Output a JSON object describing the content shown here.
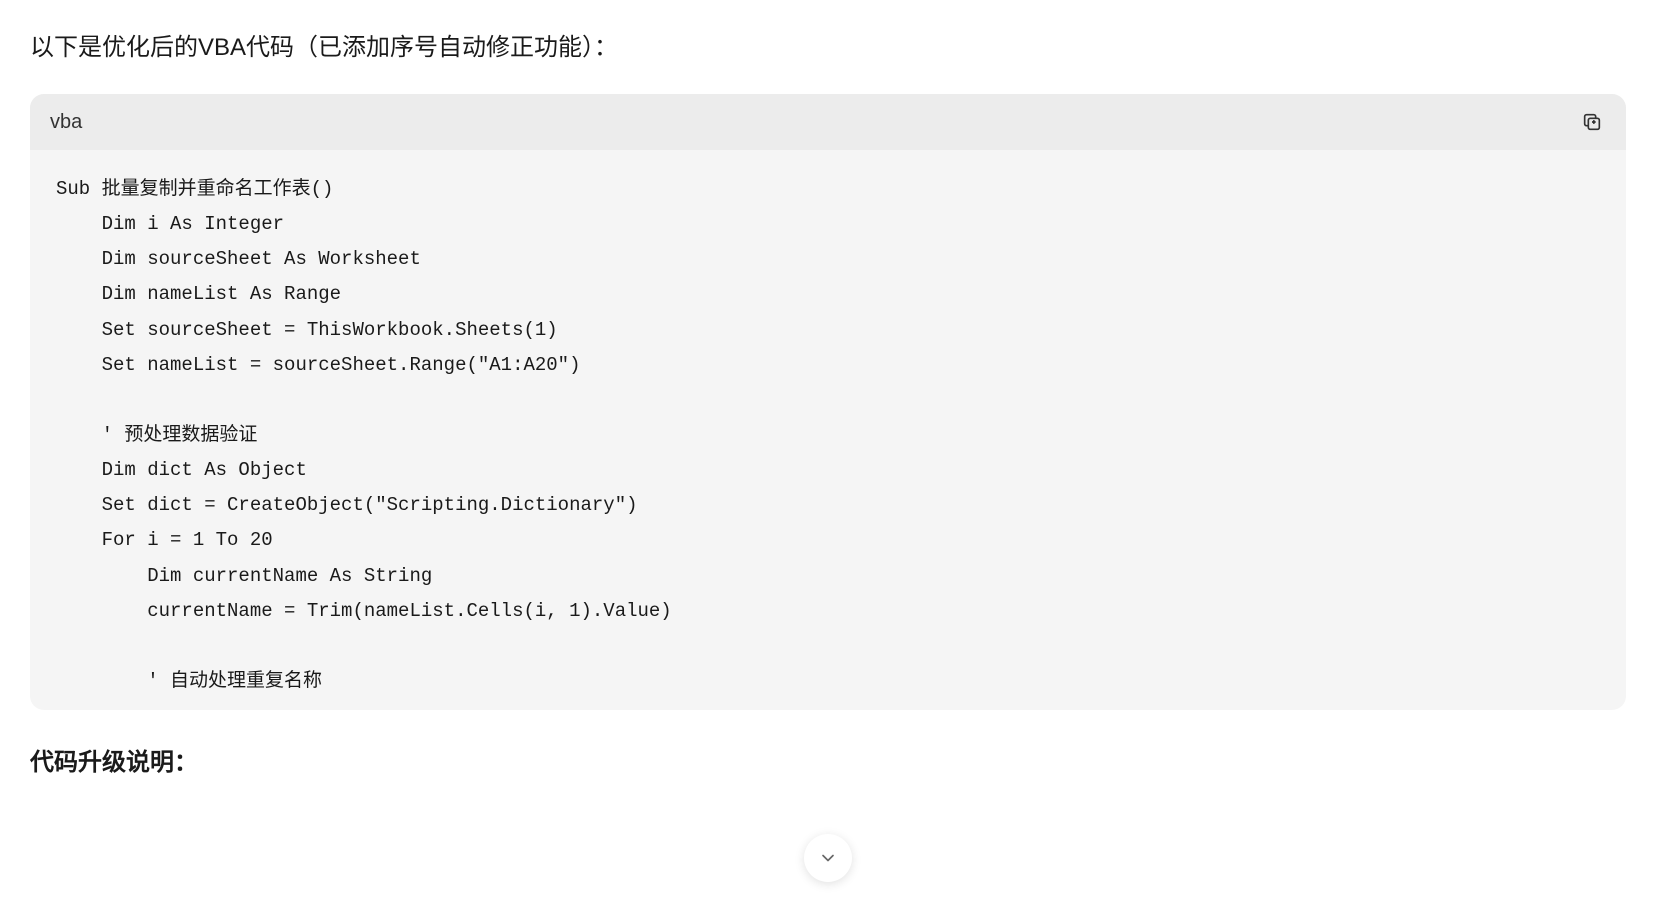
{
  "intro_text": "以下是优化后的VBA代码（已添加序号自动修正功能）：",
  "code": {
    "language": "vba",
    "content": "Sub 批量复制并重命名工作表()\n    Dim i As Integer\n    Dim sourceSheet As Worksheet\n    Dim nameList As Range\n    Set sourceSheet = ThisWorkbook.Sheets(1)\n    Set nameList = sourceSheet.Range(\"A1:A20\")\n\n    ' 预处理数据验证\n    Dim dict As Object\n    Set dict = CreateObject(\"Scripting.Dictionary\")\n    For i = 1 To 20\n        Dim currentName As String\n        currentName = Trim(nameList.Cells(i, 1).Value)\n\n        ' 自动处理重复名称"
  },
  "section_title": "代码升级说明："
}
